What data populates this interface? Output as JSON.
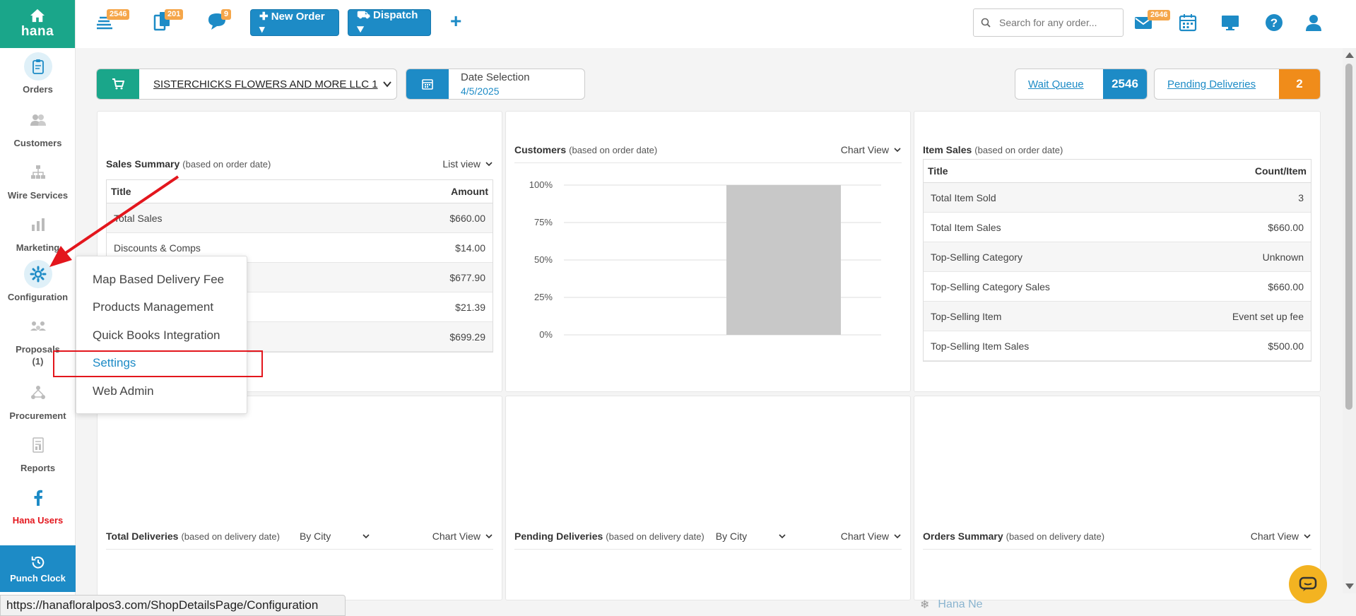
{
  "sidebar": {
    "logo": "hana",
    "items": [
      {
        "label": "Orders",
        "icon": "clipboard-icon"
      },
      {
        "label": "Customers",
        "icon": "users-icon"
      },
      {
        "label": "Wire Services",
        "icon": "sitemap-icon"
      },
      {
        "label": "Marketing",
        "icon": "bar-chart-icon"
      },
      {
        "label": "Configuration",
        "icon": "cog-icon"
      },
      {
        "label": "Proposals\n(1)",
        "icon": "people-icon"
      },
      {
        "label": "Procurement",
        "icon": "network-icon"
      },
      {
        "label": "Reports",
        "icon": "report-icon"
      },
      {
        "label": "Hana Users",
        "icon": "facebook-icon"
      }
    ],
    "punch_clock": "Punch Clock"
  },
  "topbar": {
    "badges": {
      "queue": "2546",
      "copies": "201",
      "chat": "9",
      "mail": "2646"
    },
    "new_order": "✚ New Order ▾",
    "dispatch": "⛟ Dispatch ▾",
    "plus": "+",
    "search_placeholder": "Search for any order..."
  },
  "filters": {
    "shop": "SISTERCHICKS FLOWERS AND MORE LLC 1",
    "date_label": "Date Selection",
    "date_value": "4/5/2025",
    "wait_queue_label": "Wait Queue",
    "wait_queue_count": "2546",
    "pending_label": "Pending Deliveries",
    "pending_count": "2",
    "accent_green": "#1aa68a",
    "accent_blue": "#1d8bc6",
    "accent_orange": "#f08c1a"
  },
  "sales_summary": {
    "title": "Sales Summary",
    "sub": "(based on order date)",
    "view": "List view",
    "col_title": "Title",
    "col_amount": "Amount",
    "rows": [
      {
        "title": "Total Sales",
        "amount": "$660.00"
      },
      {
        "title": "Discounts & Comps",
        "amount": "$14.00"
      },
      {
        "title": "",
        "amount": "$677.90"
      },
      {
        "title": "",
        "amount": "$21.39"
      },
      {
        "title": "",
        "amount": "$699.29"
      }
    ]
  },
  "customers": {
    "title": "Customers",
    "sub": "(based on order date)",
    "view": "Chart View"
  },
  "chart_data": {
    "type": "bar",
    "categories": [
      ""
    ],
    "values": [
      100
    ],
    "ylim": [
      0,
      100
    ],
    "yticks": [
      "100%",
      "75%",
      "50%",
      "25%",
      "0%"
    ],
    "bar_color": "#c8c8c8",
    "grid": true
  },
  "item_sales": {
    "title": "Item Sales",
    "sub": "(based on order date)",
    "col_title": "Title",
    "col_count": "Count/Item",
    "rows": [
      {
        "title": "Total Item Sold",
        "value": "3"
      },
      {
        "title": "Total Item Sales",
        "value": "$660.00"
      },
      {
        "title": "Top-Selling Category",
        "value": "Unknown"
      },
      {
        "title": "Top-Selling Category Sales",
        "value": "$660.00"
      },
      {
        "title": "Top-Selling Item",
        "value": "Event set up fee"
      },
      {
        "title": "Top-Selling Item Sales",
        "value": "$500.00"
      }
    ]
  },
  "total_deliveries": {
    "title": "Total Deliveries",
    "sub": "(based on delivery date)",
    "by": "By City",
    "view": "Chart View"
  },
  "pending_deliveries": {
    "title": "Pending Deliveries",
    "sub": "(based on delivery date)",
    "by": "By City",
    "view": "Chart View"
  },
  "orders_summary": {
    "title": "Orders Summary",
    "sub": "(based on delivery date)",
    "view": "Chart View"
  },
  "config_menu": {
    "items": [
      "Map Based Delivery Fee",
      "Products Management",
      "Quick Books Integration",
      "Settings",
      "Web Admin"
    ]
  },
  "status_url": "https://hanafloralpos3.com/ShopDetailsPage/Configuration",
  "news": "Hana Ne"
}
